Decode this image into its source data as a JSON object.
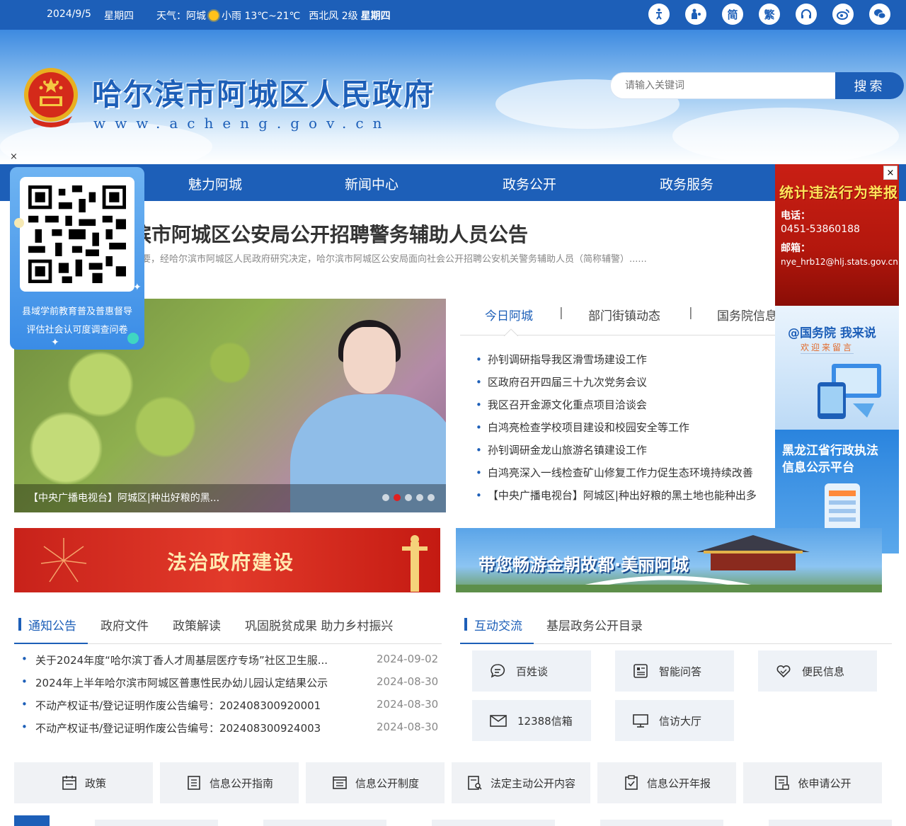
{
  "topbar": {
    "date": "2024/9/5",
    "weekday": "星期四",
    "weather": "天气：阿城",
    "weather_detail": "小雨 13℃~21℃",
    "wind": "西北风 2级",
    "weekday2": "星期四",
    "icons": [
      "accessibility-icon",
      "elder-care-icon",
      "simplified-chinese-icon",
      "traditional-chinese-icon",
      "headset-icon",
      "weibo-icon",
      "wechat-icon"
    ],
    "simplified_label": "简",
    "traditional_label": "繁"
  },
  "header": {
    "site_title": "哈尔滨市阿城区人民政府",
    "site_url": "www.acheng.gov.cn",
    "search_placeholder": "请输入关键词",
    "search_button": "搜索"
  },
  "nav": {
    "items": [
      "魅力阿城",
      "新闻中心",
      "政务公开",
      "政务服务"
    ]
  },
  "headline": {
    "title": "滨市阿城区公安局公开招聘警务辅助人员公告",
    "desc": "要，经哈尔滨市阿城区人民政府研究决定，哈尔滨市阿城区公安局面向社会公开招聘公安机关警务辅助人员（简称辅警）......"
  },
  "qr_float": {
    "close": "×",
    "text_line1": "县域学前教育普及普惠督导",
    "text_line2": "评估社会认可度调查问卷"
  },
  "slider": {
    "caption": "【中央广播电视台】阿城区|种出好粮的黑...",
    "dots": 5,
    "active_dot": 1
  },
  "news": {
    "tabs": [
      "今日阿城",
      "部门街镇动态",
      "国务院信息"
    ],
    "separator": "|",
    "items": [
      "孙钊调研指导我区滑雪场建设工作",
      "区政府召开四届三十九次党务会议",
      "我区召开金源文化重点项目洽谈会",
      "白鸿亮检查学校项目建设和校园安全等工作",
      "孙钊调研金龙山旅游名镇建设工作",
      "白鸿亮深入一线检查矿山修复工作力促生态环境持续改善",
      "【中央广播电视台】阿城区|种出好粮的黑土地也能种出多"
    ]
  },
  "right_float": {
    "close": "×",
    "ad1_title": "统计违法行为举报",
    "ad1_phone_label": "电话：",
    "ad1_phone": "0451-53860188",
    "ad1_email_label": "邮箱：",
    "ad1_email": "nye_hrb12@hlj.stats.gov.cn",
    "ad2_title": "@国务院 我来说",
    "ad2_sub": "欢迎来留言",
    "ad3_title_line1": "黑龙江省行政执法",
    "ad3_title_line2": "信息公示平台"
  },
  "banners": {
    "banner1": "法治政府建设",
    "banner2": "带您畅游金朝故都·美丽阿城"
  },
  "notice": {
    "tabs": [
      "通知公告",
      "政府文件",
      "政策解读",
      "巩固脱贫成果 助力乡村振兴"
    ],
    "items": [
      {
        "title": "关于2024年度“哈尔滨丁香人才周基层医疗专场”社区卫生服...",
        "date": "2024-09-02"
      },
      {
        "title": "2024年上半年哈尔滨市阿城区普惠性民办幼儿园认定结果公示",
        "date": "2024-08-30"
      },
      {
        "title": "不动产权证书/登记证明作废公告编号：202408300920001",
        "date": "2024-08-30"
      },
      {
        "title": "不动产权证书/登记证明作废公告编号：202408300924003",
        "date": "2024-08-30"
      }
    ]
  },
  "interaction": {
    "tabs": [
      "互动交流",
      "基层政务公开目录"
    ],
    "cards": [
      "百姓谈",
      "智能问答",
      "便民信息",
      "12388信箱",
      "信访大厅"
    ]
  },
  "bottom_row": {
    "items": [
      "政策",
      "信息公开指南",
      "信息公开制度",
      "法定主动公开内容",
      "信息公开年报",
      "依申请公开"
    ]
  },
  "colors": {
    "primary": "#1d5fb8",
    "red_banner": "#c8221a"
  }
}
